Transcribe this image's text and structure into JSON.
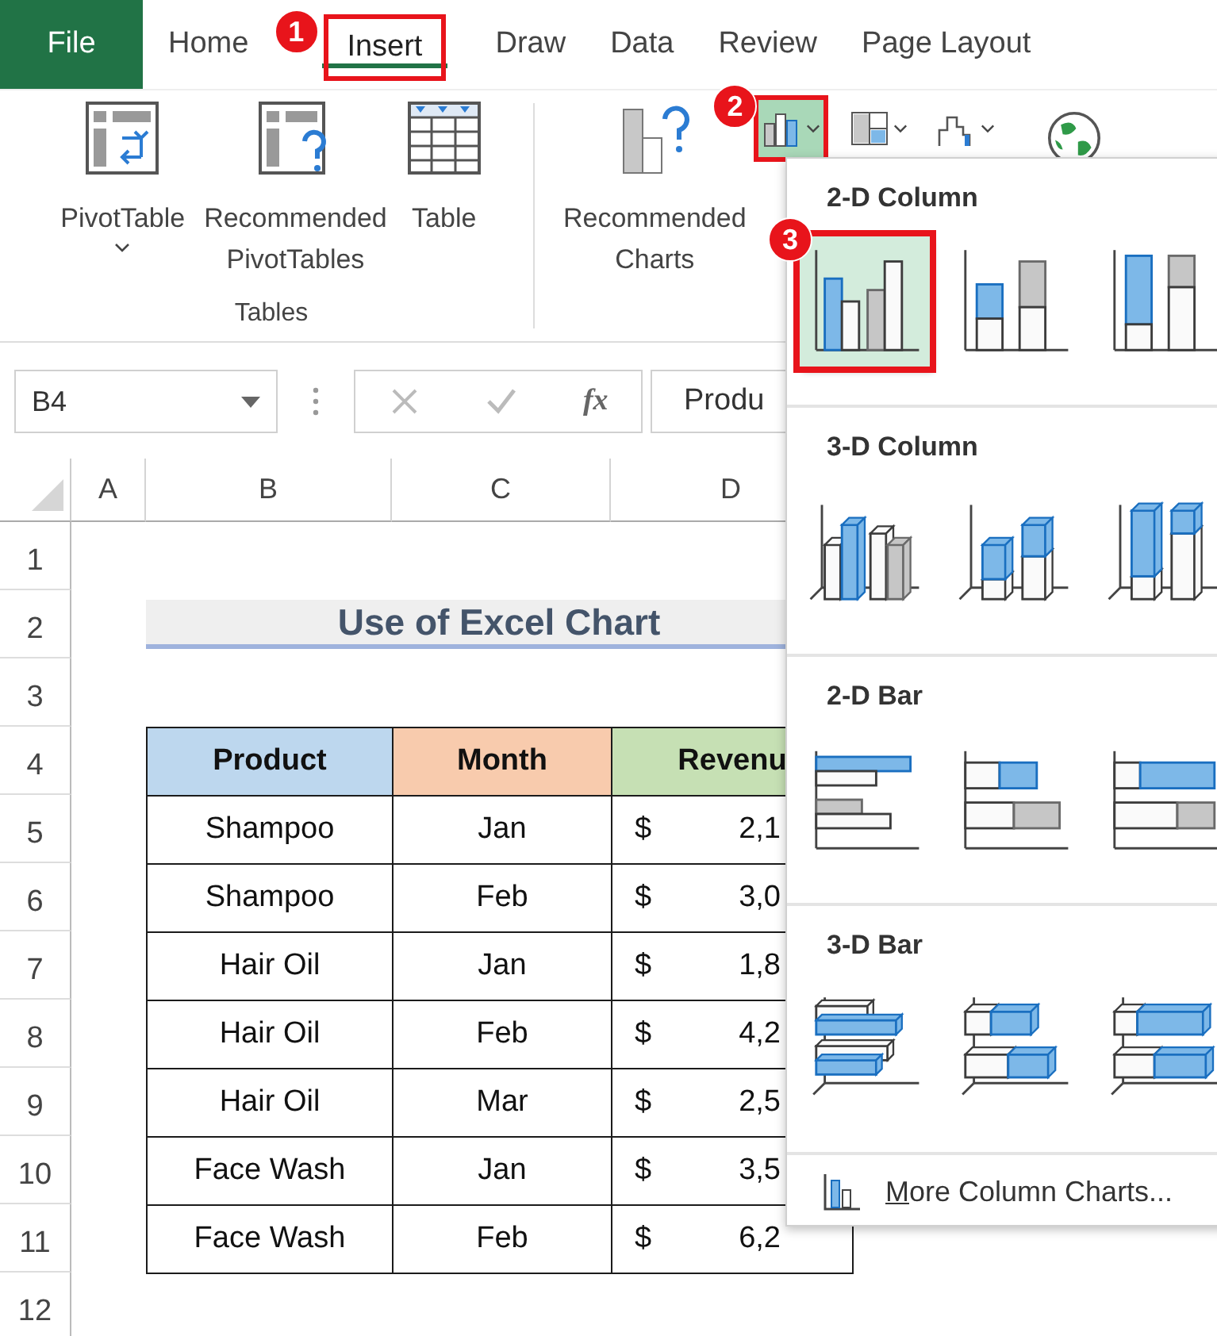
{
  "ribbon_tabs": [
    {
      "label": "File",
      "kind": "file",
      "selected": false
    },
    {
      "label": "Home",
      "kind": "tab",
      "selected": false
    },
    {
      "label": "Insert",
      "kind": "tab",
      "selected": true,
      "callout": "1"
    },
    {
      "label": "Draw",
      "kind": "tab",
      "selected": false
    },
    {
      "label": "Data",
      "kind": "tab",
      "selected": false
    },
    {
      "label": "Review",
      "kind": "tab",
      "selected": false
    },
    {
      "label": "Page Layout",
      "kind": "tab",
      "selected": false
    }
  ],
  "ribbon": {
    "tables_group": {
      "label": "Tables",
      "buttons": [
        {
          "kind": "pivot",
          "lines": [
            "PivotTable"
          ],
          "has_menu": true
        },
        {
          "kind": "recommended-pivot",
          "lines": [
            "Recommended",
            "PivotTables"
          ],
          "has_menu": false
        },
        {
          "kind": "table",
          "lines": [
            "Table"
          ],
          "has_menu": false
        }
      ]
    },
    "recommended_charts": {
      "lines": [
        "Recommended",
        "Charts"
      ]
    },
    "chart_buttons": [
      {
        "kind": "column",
        "selected": true,
        "has_menu": true,
        "callout": "2"
      },
      {
        "kind": "hierarchy",
        "selected": false,
        "has_menu": true
      },
      {
        "kind": "waterfall",
        "selected": false,
        "has_menu": true
      },
      {
        "kind": "map",
        "selected": false,
        "has_menu": false
      }
    ]
  },
  "formula_bar": {
    "name_box": "B4",
    "function_label": "fx",
    "formula": "Produ"
  },
  "sheet": {
    "columns": [
      "A",
      "B",
      "C",
      "D"
    ],
    "rows": [
      "1",
      "2",
      "3",
      "4",
      "5",
      "6",
      "7",
      "8",
      "9",
      "10",
      "11",
      "12"
    ],
    "title": "Use of Excel Chart",
    "table": {
      "columns": [
        {
          "label": "Product",
          "color": "#bdd7ee"
        },
        {
          "label": "Month",
          "color": "#f8cbad"
        },
        {
          "label": "Revenu",
          "color": "#c6e0b4"
        }
      ],
      "rows": [
        {
          "product": "Shampoo",
          "month": "Jan",
          "currency": "$",
          "revenue": "2,1"
        },
        {
          "product": "Shampoo",
          "month": "Feb",
          "currency": "$",
          "revenue": "3,0"
        },
        {
          "product": "Hair Oil",
          "month": "Jan",
          "currency": "$",
          "revenue": "1,8"
        },
        {
          "product": "Hair Oil",
          "month": "Feb",
          "currency": "$",
          "revenue": "4,2"
        },
        {
          "product": "Hair Oil",
          "month": "Mar",
          "currency": "$",
          "revenue": "2,5"
        },
        {
          "product": "Face Wash",
          "month": "Jan",
          "currency": "$",
          "revenue": "3,5"
        },
        {
          "product": "Face Wash",
          "month": "Feb",
          "currency": "$",
          "revenue": "6,2"
        }
      ]
    }
  },
  "chart_menu": {
    "sections": [
      {
        "title": "2-D Column",
        "kind": "column2d",
        "options": [
          {
            "kind": "clustered",
            "selected": true,
            "callout": "3"
          },
          {
            "kind": "stacked",
            "selected": false
          },
          {
            "kind": "percent",
            "selected": false
          }
        ]
      },
      {
        "title": "3-D Column",
        "kind": "column3d",
        "options": [
          {
            "kind": "clustered",
            "selected": false
          },
          {
            "kind": "stacked",
            "selected": false
          },
          {
            "kind": "percent",
            "selected": false
          }
        ]
      },
      {
        "title": "2-D Bar",
        "kind": "bar2d",
        "options": [
          {
            "kind": "clustered",
            "selected": false
          },
          {
            "kind": "stacked",
            "selected": false
          },
          {
            "kind": "percent",
            "selected": false
          }
        ]
      },
      {
        "title": "3-D Bar",
        "kind": "bar3d",
        "options": [
          {
            "kind": "clustered",
            "selected": false
          },
          {
            "kind": "stacked",
            "selected": false
          },
          {
            "kind": "percent",
            "selected": false
          }
        ]
      }
    ],
    "footer": "More Column Charts..."
  }
}
